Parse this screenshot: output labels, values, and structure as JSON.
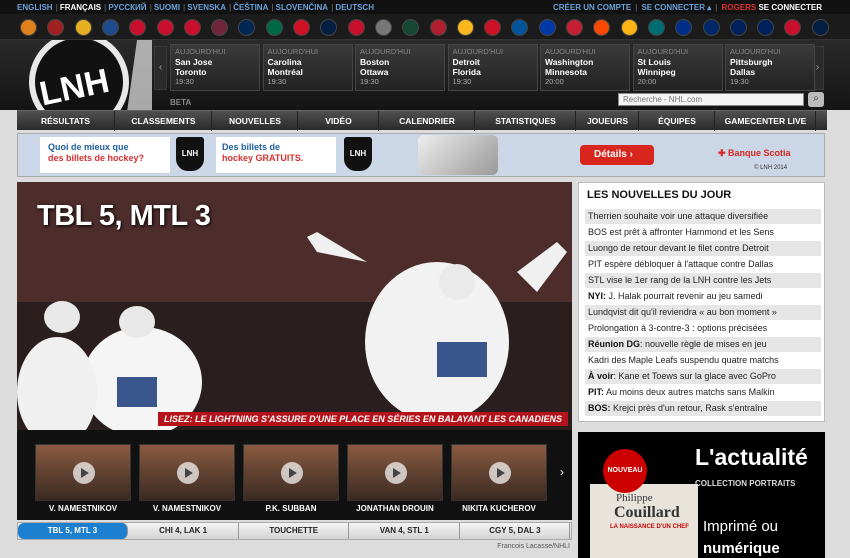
{
  "top_bar": {
    "languages": [
      "ENGLISH",
      "FRANÇAIS",
      "РУССКИЙ",
      "SUOMI",
      "SVENSKA",
      "ČEŠTINA",
      "SLOVENČINA",
      "DEUTSCH"
    ],
    "current_language": "FRANÇAIS",
    "create_account": "CRÉER UN COMPTE",
    "login": "SE CONNECTER",
    "rogers": "ROGERS",
    "rogers_login": "SE CONNECTER"
  },
  "teams": [
    {
      "name": "ducks",
      "color": "#e0801c"
    },
    {
      "name": "coyotes",
      "color": "#a02020"
    },
    {
      "name": "bruins",
      "color": "#e8b020"
    },
    {
      "name": "sabres",
      "color": "#1d4a8c"
    },
    {
      "name": "flames",
      "color": "#c8102e"
    },
    {
      "name": "hurricanes",
      "color": "#c8102e"
    },
    {
      "name": "blackhawks",
      "color": "#c8102e"
    },
    {
      "name": "avalanche",
      "color": "#6f263d"
    },
    {
      "name": "blue-jackets",
      "color": "#002654"
    },
    {
      "name": "stars",
      "color": "#006847"
    },
    {
      "name": "red-wings",
      "color": "#ce1126"
    },
    {
      "name": "oilers",
      "color": "#041e42"
    },
    {
      "name": "panthers",
      "color": "#c8102e"
    },
    {
      "name": "kings",
      "color": "#777777"
    },
    {
      "name": "wild",
      "color": "#154734"
    },
    {
      "name": "canadiens",
      "color": "#af1e2d"
    },
    {
      "name": "predators",
      "color": "#ffb81c"
    },
    {
      "name": "devils",
      "color": "#ce1126"
    },
    {
      "name": "islanders",
      "color": "#00539b"
    },
    {
      "name": "rangers",
      "color": "#0038a8"
    },
    {
      "name": "senators",
      "color": "#c52032"
    },
    {
      "name": "flyers",
      "color": "#f74902"
    },
    {
      "name": "penguins",
      "color": "#fcb514"
    },
    {
      "name": "sharks",
      "color": "#006d75"
    },
    {
      "name": "blues",
      "color": "#002f87"
    },
    {
      "name": "lightning",
      "color": "#002868"
    },
    {
      "name": "maple-leafs",
      "color": "#00205b"
    },
    {
      "name": "canucks",
      "color": "#00205b"
    },
    {
      "name": "capitals",
      "color": "#c8102e"
    },
    {
      "name": "jets",
      "color": "#041e42"
    }
  ],
  "games": [
    {
      "when": "AUJOURD'HUI",
      "home": "San Jose",
      "away": "Toronto",
      "time": "19:30"
    },
    {
      "when": "AUJOURD'HUI",
      "home": "Carolina",
      "away": "Montréal",
      "time": "19:30"
    },
    {
      "when": "AUJOURD'HUI",
      "home": "Boston",
      "away": "Ottawa",
      "time": "19:30"
    },
    {
      "when": "AUJOURD'HUI",
      "home": "Detroit",
      "away": "Florida",
      "time": "19:30"
    },
    {
      "when": "AUJOURD'HUI",
      "home": "Washington",
      "away": "Minnesota",
      "time": "20:00"
    },
    {
      "when": "AUJOURD'HUI",
      "home": "St Louis",
      "away": "Winnipeg",
      "time": "20:00"
    },
    {
      "when": "AUJOURD'HUI",
      "home": "Pittsburgh",
      "away": "Dallas",
      "time": "19:30"
    }
  ],
  "logo": {
    "text": "LNH"
  },
  "beta": "BETA",
  "search": {
    "placeholder": "Recherche - NHL.com"
  },
  "nav": [
    "RÉSULTATS",
    "CLASSEMENTS",
    "NOUVELLES",
    "VIDÉO",
    "CALENDRIER",
    "STATISTIQUES",
    "JOUEURS",
    "ÉQUIPES",
    "GAMECENTER LIVE"
  ],
  "ad": {
    "line1a": "Quoi de mieux que",
    "line1b": "des billets de hockey?",
    "line2a": "Des billets de",
    "line2b": "hockey GRATUITS.",
    "lnh": "LNH",
    "button": "Détails",
    "bank": "Banque Scotia",
    "copyright": "© LNH 2014"
  },
  "hero": {
    "headline": "TBL 5, MTL 3",
    "caption": "LISEZ: LE LIGHTNING S'ASSURE D'UNE PLACE EN SÉRIES EN BALAYANT LES CANADIENS",
    "credit": "Francois Lacasse/NHLI"
  },
  "videos": [
    {
      "label": "V. NAMESTNIKOV"
    },
    {
      "label": "V. NAMESTNIKOV"
    },
    {
      "label": "P.K. SUBBAN"
    },
    {
      "label": "JONATHAN DROUIN"
    },
    {
      "label": "NIKITA KUCHEROV"
    }
  ],
  "score_tabs": [
    "TBL 5, MTL 3",
    "CHI 4, LAK 1",
    "TOUCHETTE",
    "VAN 4, STL 1",
    "CGY 5, DAL 3"
  ],
  "news": {
    "title": "LES NOUVELLES DU JOUR",
    "items": [
      {
        "prefix": "",
        "text": "Therrien souhaite voir une attaque diversifiée"
      },
      {
        "prefix": "",
        "text": "BOS est prêt à affronter Hammond et les Sens"
      },
      {
        "prefix": "",
        "text": "Luongo de retour devant le filet contre Detroit"
      },
      {
        "prefix": "",
        "text": "PIT espère débloquer à l'attaque contre Dallas"
      },
      {
        "prefix": "",
        "text": "STL vise le 1er rang de la LNH contre les Jets"
      },
      {
        "prefix": "NYI:",
        "text": " J. Halak pourrait revenir au jeu samedi"
      },
      {
        "prefix": "",
        "text": "Lundqvist dit qu'il reviendra « au bon moment »"
      },
      {
        "prefix": "",
        "text": "Prolongation à 3-contre-3 : options précisées"
      },
      {
        "prefix": "Réunion DG",
        "text": ": nouvelle règle de mises en jeu"
      },
      {
        "prefix": "",
        "text": "Kadri des Maple Leafs suspendu quatre matchs"
      },
      {
        "prefix": "À voir",
        "text": ": Kane et Toews sur la glace avec GoPro"
      },
      {
        "prefix": "PIT:",
        "text": " Au moins deux autres matchs sans Malkin"
      },
      {
        "prefix": "BOS:",
        "text": " Krejci près d'un retour, Rask s'entraîne"
      }
    ]
  },
  "promo": {
    "badge": "NOUVEAU",
    "author_first": "Philippe",
    "author_last": "Couillard",
    "book_sub": "LA NAISSANCE D'UN CHEF",
    "title": "L'actualité",
    "collection_a": "COLLECTION",
    "collection_b": "PORTRAITS",
    "line1a": "Imprimé",
    "line1b": "ou",
    "line2": "numérique"
  }
}
